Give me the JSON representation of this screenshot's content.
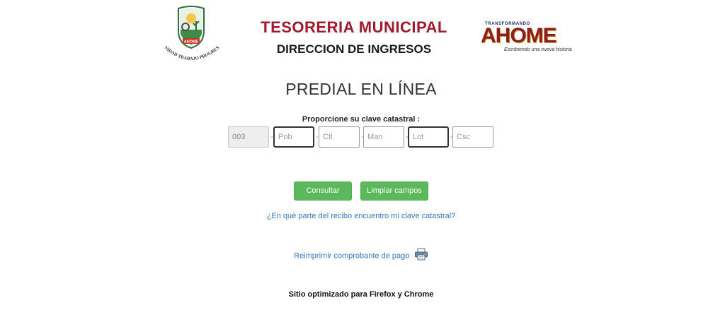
{
  "header": {
    "left_logo": {
      "icon": "ahome-municipal-seal",
      "banner_text": "AHOME",
      "motto": "UNIDAD TRABAJO PROGRESO"
    },
    "title": "TESORERIA MUNICIPAL",
    "subtitle": "DIRECCION DE INGRESOS",
    "right_logo": {
      "small": "TRANSFORMANDO",
      "brand": "AHOME",
      "tagline": "Escribiendo una nueva historia"
    }
  },
  "main": {
    "heading": "PREDIAL EN LÍNEA",
    "prompt": "Proporcione su clave catastral :",
    "fields": [
      {
        "value": "003",
        "placeholder": "",
        "disabled": true
      },
      {
        "value": "",
        "placeholder": "Pob"
      },
      {
        "value": "",
        "placeholder": "Ctl"
      },
      {
        "value": "",
        "placeholder": "Man"
      },
      {
        "value": "",
        "placeholder": "Lot"
      },
      {
        "value": "",
        "placeholder": "Csc"
      }
    ],
    "separator": "-",
    "buttons": {
      "consultar": "Consultar",
      "limpiar": "Limpiar campos"
    },
    "help_link": "¿En qué parte del recibo encuentro mi clave catastral?",
    "reprint_link": "Reimprimir comprobante de pago",
    "reprint_icon": "printer-icon"
  },
  "footer": {
    "note": "Sitio optimizado para Firefox y Chrome"
  },
  "colors": {
    "title": "#a0192d",
    "button": "#5cb85c",
    "link": "#3777b8"
  }
}
